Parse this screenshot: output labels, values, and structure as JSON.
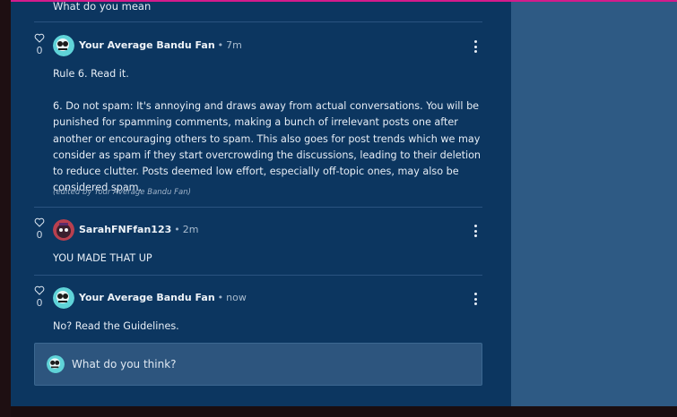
{
  "previous_comment": {
    "text": "What do you mean"
  },
  "comments": [
    {
      "likes": "0",
      "author": "Your Average Bandu Fan",
      "time": "7m",
      "paragraphs": [
        "Rule 6. Read it.",
        "6. Do not spam: It's annoying and draws away from actual conversations. You will be punished for spamming comments, making a bunch of irrelevant posts one after another or encouraging others to spam. This also goes for post trends which we may consider as spam if they start overcrowding the discussions, leading to their deletion to reduce clutter. Posts deemed low effort, especially off-topic ones, may also be considered spam."
      ],
      "edited": "(edited by Your Average Bandu Fan)"
    },
    {
      "likes": "0",
      "author": "SarahFNFfan123",
      "time": "2m",
      "paragraphs": [
        "YOU MADE THAT UP"
      ]
    },
    {
      "likes": "0",
      "author": "Your Average Bandu Fan",
      "time": "now",
      "paragraphs": [
        "No? Read the Guidelines."
      ]
    }
  ],
  "reply": {
    "placeholder": "What do you think?"
  },
  "icons": {
    "like": "heart-icon",
    "more": "more-options-icon",
    "avatar": "user-avatar"
  },
  "colors": {
    "panel": "#0c3660",
    "accent": "#d41b8c",
    "side": "#2e5a84"
  }
}
